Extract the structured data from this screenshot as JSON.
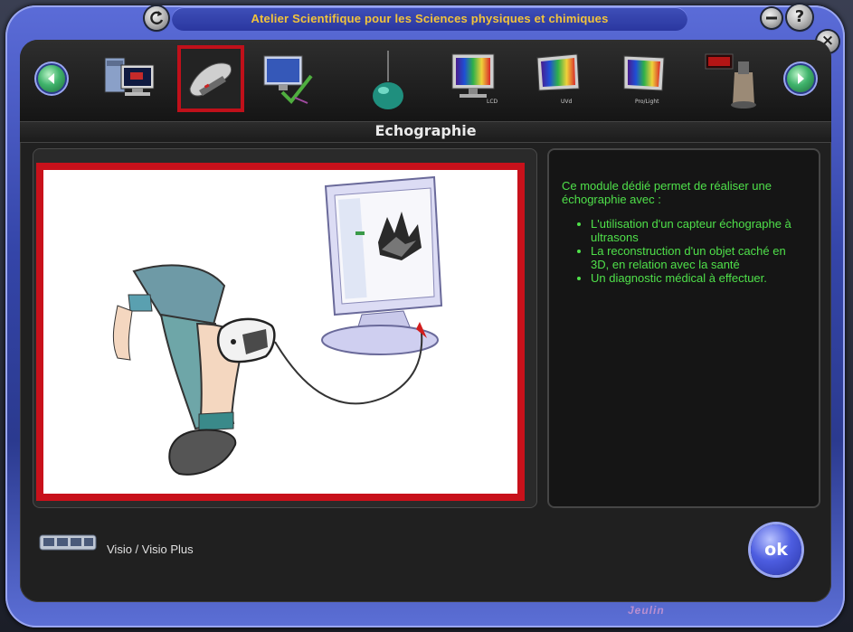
{
  "window": {
    "title": "Atelier Scientifique pour les Sciences physiques et chimiques",
    "buttons": {
      "refresh_icon": "refresh-icon",
      "minimize_icon": "minimize-icon",
      "help_symbol": "?",
      "close_symbol": "×"
    }
  },
  "toolbar": {
    "prev_icon": "arrow-left-icon",
    "next_icon": "arrow-right-icon",
    "tools": [
      {
        "icon": "computer-interface-icon",
        "caption": "",
        "selected": false
      },
      {
        "icon": "ultrasound-probe-icon",
        "caption": "",
        "selected": true
      },
      {
        "icon": "monitor-check-icon",
        "caption": "",
        "selected": false
      },
      {
        "icon": "flask-icon",
        "caption": "",
        "selected": false
      },
      {
        "icon": "spectrum-lcd-icon",
        "caption": "LCD",
        "selected": false
      },
      {
        "icon": "spectrum-uvd-icon",
        "caption": "UVd",
        "selected": false
      },
      {
        "icon": "spectrum-pro-icon",
        "caption": "Pro/Light",
        "selected": false
      },
      {
        "icon": "sensor-display-icon",
        "caption": "",
        "selected": false
      }
    ]
  },
  "section": {
    "title": "Echographie"
  },
  "description": {
    "intro": "Ce module dédié permet de réaliser une échographie avec :",
    "bullets": [
      "L'utilisation d'un capteur échographe à ultrasons",
      "La reconstruction d'un objet caché en 3D, en relation avec la santé",
      "Un diagnostic médical à effectuer."
    ]
  },
  "footer": {
    "product_label": "Visio / Visio Plus",
    "ok_label": "ok",
    "brand": "Jeulin"
  },
  "colors": {
    "frame_blue": "#3445a8",
    "title_yellow": "#f3c43a",
    "description_green": "#4fe04a",
    "selection_red": "#c8111b"
  }
}
